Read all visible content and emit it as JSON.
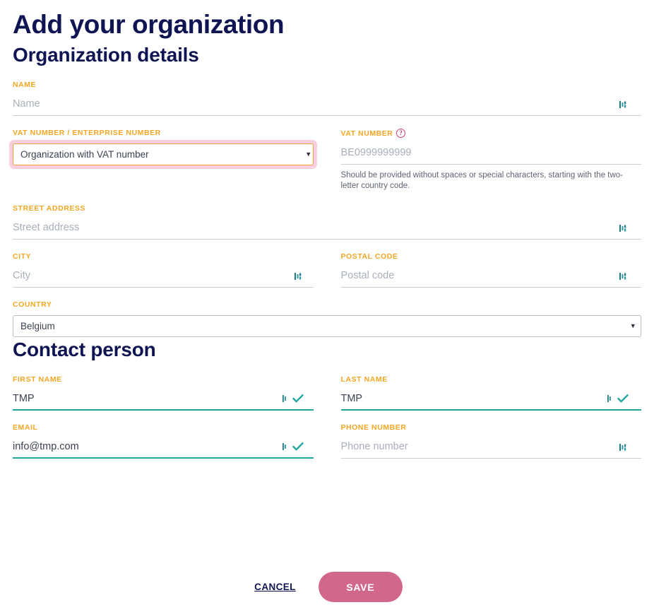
{
  "page": {
    "title": "Add your organization"
  },
  "sections": {
    "organization": {
      "title": "Organization details",
      "fields": {
        "name": {
          "label": "NAME",
          "placeholder": "Name",
          "value": ""
        },
        "vat_type": {
          "label": "VAT NUMBER / ENTERPRISE NUMBER",
          "value": "Organization with VAT number",
          "options": [
            "Organization with VAT number"
          ]
        },
        "vat_number": {
          "label": "VAT NUMBER",
          "help_icon": "question-mark-icon",
          "placeholder": "BE0999999999",
          "value": "",
          "hint": "Should be provided without spaces or special characters, starting with the two-letter country code."
        },
        "street_address": {
          "label": "STREET ADDRESS",
          "placeholder": "Street address",
          "value": ""
        },
        "city": {
          "label": "CITY",
          "placeholder": "City",
          "value": ""
        },
        "postal_code": {
          "label": "POSTAL CODE",
          "placeholder": "Postal code",
          "value": ""
        },
        "country": {
          "label": "COUNTRY",
          "value": "Belgium",
          "options": [
            "Belgium"
          ]
        }
      }
    },
    "contact": {
      "title": "Contact person",
      "fields": {
        "first_name": {
          "label": "FIRST NAME",
          "placeholder": "First name",
          "value": "TMP"
        },
        "last_name": {
          "label": "LAST NAME",
          "placeholder": "Last name",
          "value": "TMP"
        },
        "email": {
          "label": "EMAIL",
          "placeholder": "Email",
          "value": "info@tmp.com"
        },
        "phone": {
          "label": "PHONE NUMBER",
          "placeholder": "Phone number",
          "value": ""
        }
      }
    }
  },
  "actions": {
    "cancel_label": "CANCEL",
    "save_label": "SAVE"
  },
  "icons": {
    "select_arrows": "↕",
    "help": "?"
  },
  "colors": {
    "heading": "#0f1552",
    "label": "#f5a623",
    "valid_underline": "#21a5a0",
    "focus_border": "#efa23c",
    "focus_glow": "#f9cfe0",
    "help_icon": "#cf3d72",
    "save_button": "#d2678e",
    "icon_teal": "#1f7a87"
  }
}
